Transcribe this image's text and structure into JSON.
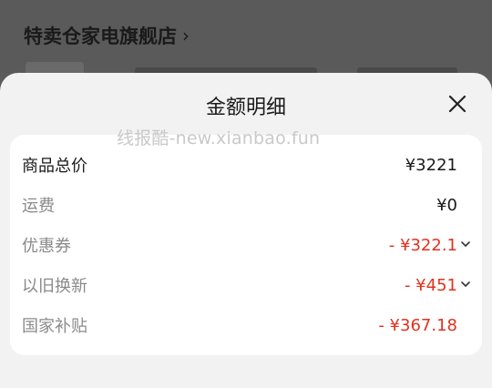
{
  "background": {
    "shop_name": "特卖仓家电旗舰店",
    "shop_chevron": "›"
  },
  "sheet": {
    "title": "金额明细",
    "watermark": "线报酷-new.xianbao.fun",
    "close_icon": "close-icon"
  },
  "breakdown": [
    {
      "label": "商品总价",
      "value": "¥3221",
      "label_style": "strong",
      "value_style": "default",
      "expandable": false
    },
    {
      "label": "运费",
      "value": "¥0",
      "label_style": "muted",
      "value_style": "default",
      "expandable": false
    },
    {
      "label": "优惠券",
      "value": "- ¥322.1",
      "label_style": "muted",
      "value_style": "red",
      "expandable": true
    },
    {
      "label": "以旧换新",
      "value": "- ¥451",
      "label_style": "muted",
      "value_style": "red",
      "expandable": true
    },
    {
      "label": "国家补贴",
      "value": "- ¥367.18",
      "label_style": "muted",
      "value_style": "red",
      "expandable": false
    }
  ],
  "colors": {
    "discount_red": "#e0321e",
    "sheet_bg": "#f2f2f2",
    "card_bg": "#ffffff",
    "overlay": "#5c5c5c"
  }
}
